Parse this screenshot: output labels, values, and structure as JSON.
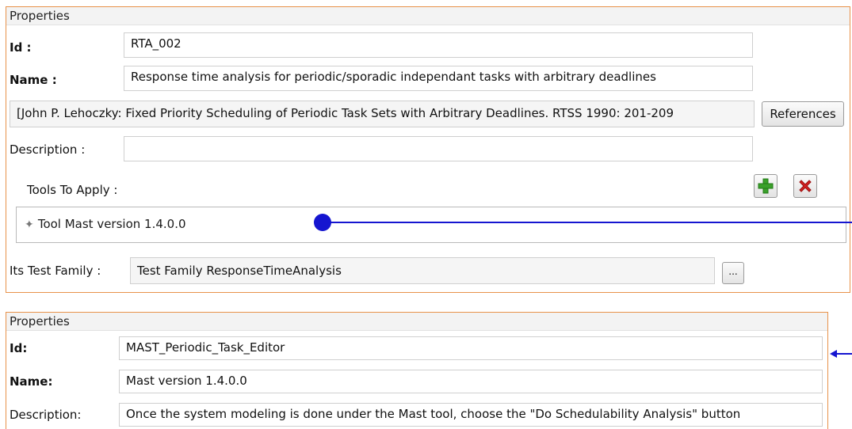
{
  "top_panel": {
    "header": "Properties",
    "id_label": "Id :",
    "id_value": "RTA_002",
    "name_label": "Name :",
    "name_value": "Response time analysis  for periodic/sporadic independant tasks with arbitrary deadlines",
    "reference_value": "[John P. Lehoczky: Fixed Priority Scheduling of Periodic Task Sets with Arbitrary Deadlines. RTSS 1990: 201-209",
    "references_button": "References",
    "description_label": "Description :",
    "description_value": "",
    "tools_label": "Tools To Apply :",
    "tools": [
      {
        "label": "Tool Mast version 1.4.0.0"
      }
    ],
    "test_family_label": "Its Test Family :",
    "test_family_value": "Test Family ResponseTimeAnalysis",
    "browse_button": "..."
  },
  "bottom_panel": {
    "header": "Properties",
    "id_label": "Id:",
    "id_value": "MAST_Periodic_Task_Editor",
    "name_label": "Name:",
    "name_value": "Mast version 1.4.0.0",
    "description_label": "Description:",
    "description_value": "Once the system modeling is done under the Mast tool, choose the \"Do Schedulability Analysis\" button"
  },
  "colors": {
    "panel_border": "#e8924a",
    "connector": "#1515d0",
    "add_icon": "#3aa02a",
    "remove_icon": "#d42020"
  },
  "icons": [
    "add-icon",
    "remove-icon",
    "tool-node-icon",
    "arrow-left-icon"
  ]
}
